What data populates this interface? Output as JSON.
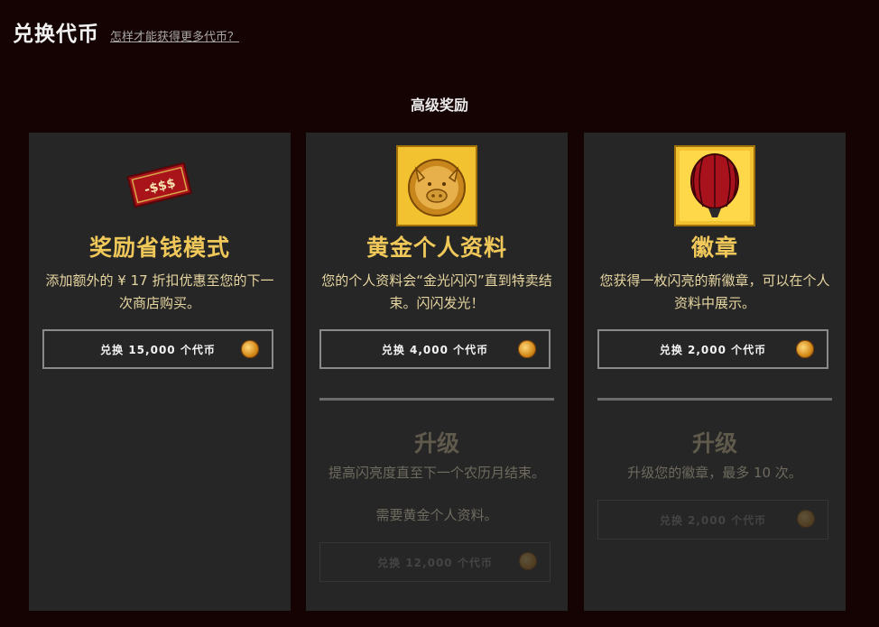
{
  "header": {
    "title": "兑换代币",
    "help_link": "怎样才能获得更多代币？"
  },
  "section_title": "高级奖励",
  "cards": [
    {
      "icon": "red-envelope-icon",
      "icon_text": "-$$$",
      "title": "奖励省钱模式",
      "description": "添加额外的 ¥ 17 折扣优惠至您的下一次商店购买。",
      "redeem_label": "兑换 15,000 个代币"
    },
    {
      "icon": "gold-pig-icon",
      "title": "黄金个人资料",
      "description": "您的个人资料会“金光闪闪”直到特卖结束。闪闪发光！",
      "redeem_label": "兑换 4,000 个代币",
      "upgrade": {
        "title": "升级",
        "description": "提高闪亮度直至下一个农历月结束。",
        "requirement": "需要黄金个人资料。",
        "redeem_label": "兑换 12,000 个代币"
      }
    },
    {
      "icon": "red-lantern-badge-icon",
      "title": "徽章",
      "description": "您获得一枚闪亮的新徽章，可以在个人资料中展示。",
      "redeem_label": "兑换 2,000 个代币",
      "upgrade": {
        "title": "升级",
        "description": "升级您的徽章，最多 10 次。",
        "redeem_label": "兑换 2,000 个代币"
      }
    }
  ],
  "colors": {
    "background": "#150203",
    "card": "#262626",
    "gold": "#f0c85a",
    "desc": "#e6d5a0"
  }
}
